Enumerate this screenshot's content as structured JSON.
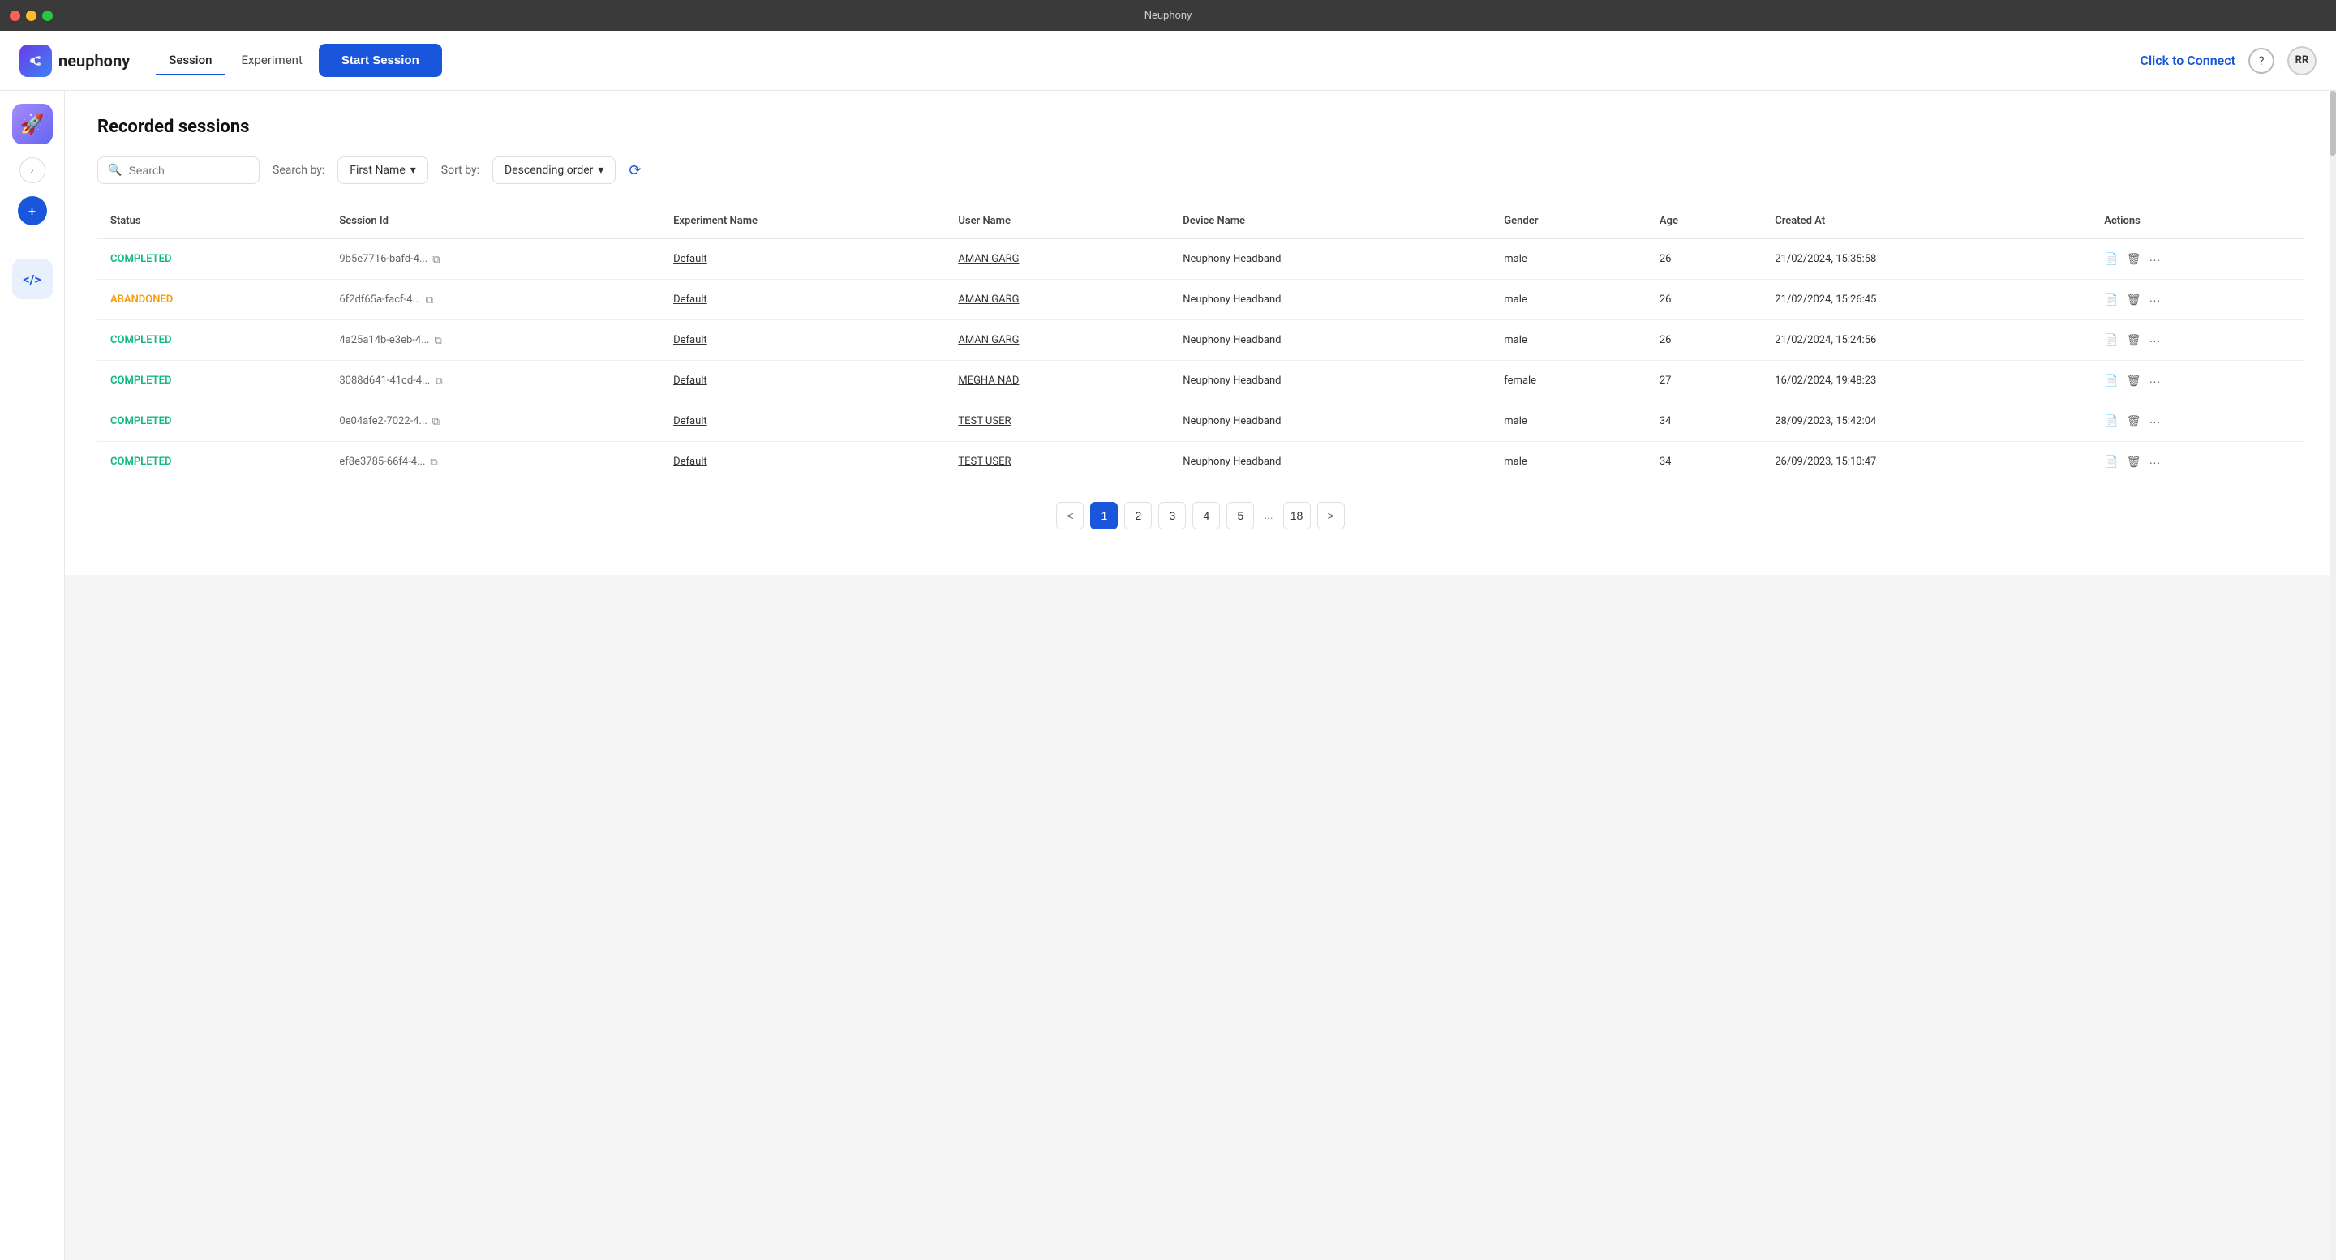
{
  "app": {
    "title": "Neuphony",
    "logo_text": "neuphony",
    "logo_emoji": "🚀"
  },
  "titlebar": {
    "title": "Neuphony"
  },
  "nav": {
    "session_label": "Session",
    "experiment_label": "Experiment",
    "start_session_label": "Start Session",
    "click_to_connect_label": "Click to Connect",
    "help_icon": "?",
    "avatar_initials": "RR"
  },
  "sidebar": {
    "expand_icon": "›",
    "add_icon": "+",
    "code_icon": "<>"
  },
  "page": {
    "title": "Recorded sessions"
  },
  "filters": {
    "search_placeholder": "Search",
    "search_by_label": "Search by:",
    "search_by_value": "First Name",
    "sort_by_label": "Sort by:",
    "sort_by_value": "Descending order"
  },
  "table": {
    "columns": [
      "Status",
      "Session Id",
      "Experiment Name",
      "User Name",
      "Device Name",
      "Gender",
      "Age",
      "Created At",
      "Actions"
    ],
    "rows": [
      {
        "status": "COMPLETED",
        "status_class": "completed",
        "session_id": "9b5e7716-bafd-4...",
        "experiment_name": "Default",
        "user_name": "AMAN GARG",
        "device_name": "Neuphony Headband",
        "gender": "male",
        "age": "26",
        "created_at": "21/02/2024, 15:35:58"
      },
      {
        "status": "ABANDONED",
        "status_class": "abandoned",
        "session_id": "6f2df65a-facf-4...",
        "experiment_name": "Default",
        "user_name": "AMAN GARG",
        "device_name": "Neuphony Headband",
        "gender": "male",
        "age": "26",
        "created_at": "21/02/2024, 15:26:45"
      },
      {
        "status": "COMPLETED",
        "status_class": "completed",
        "session_id": "4a25a14b-e3eb-4...",
        "experiment_name": "Default",
        "user_name": "AMAN GARG",
        "device_name": "Neuphony Headband",
        "gender": "male",
        "age": "26",
        "created_at": "21/02/2024, 15:24:56"
      },
      {
        "status": "COMPLETED",
        "status_class": "completed",
        "session_id": "3088d641-41cd-4...",
        "experiment_name": "Default",
        "user_name": "MEGHA NAD",
        "device_name": "Neuphony Headband",
        "gender": "female",
        "age": "27",
        "created_at": "16/02/2024, 19:48:23"
      },
      {
        "status": "COMPLETED",
        "status_class": "completed",
        "session_id": "0e04afe2-7022-4...",
        "experiment_name": "Default",
        "user_name": "TEST USER",
        "device_name": "Neuphony Headband",
        "gender": "male",
        "age": "34",
        "created_at": "28/09/2023, 15:42:04"
      },
      {
        "status": "COMPLETED",
        "status_class": "completed",
        "session_id": "ef8e3785-66f4-4...",
        "experiment_name": "Default",
        "user_name": "TEST USER",
        "device_name": "Neuphony Headband",
        "gender": "male",
        "age": "34",
        "created_at": "26/09/2023, 15:10:47"
      }
    ]
  },
  "pagination": {
    "prev_label": "<",
    "next_label": ">",
    "ellipsis": "...",
    "pages": [
      "1",
      "2",
      "3",
      "4",
      "5",
      "...",
      "18"
    ],
    "active_page": "1"
  }
}
